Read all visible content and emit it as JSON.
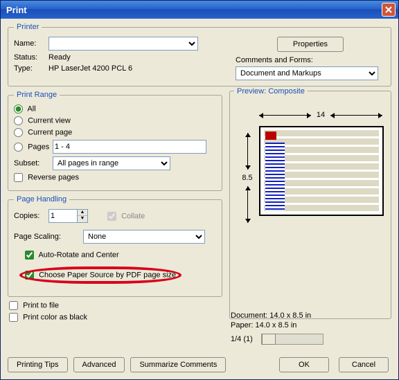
{
  "title": "Print",
  "printer": {
    "legend": "Printer",
    "name_label": "Name:",
    "name_value": "",
    "status_label": "Status:",
    "status_value": "Ready",
    "type_label": "Type:",
    "type_value": "HP LaserJet 4200 PCL 6",
    "properties_btn": "Properties",
    "comments_label": "Comments and Forms:",
    "comments_value": "Document and Markups"
  },
  "range": {
    "legend": "Print Range",
    "all": "All",
    "current_view": "Current view",
    "current_page": "Current page",
    "pages_label": "Pages",
    "pages_value": "1 - 4",
    "subset_label": "Subset:",
    "subset_value": "All pages in range",
    "reverse": "Reverse pages"
  },
  "handling": {
    "legend": "Page Handling",
    "copies_label": "Copies:",
    "copies_value": "1",
    "collate": "Collate",
    "scaling_label": "Page Scaling:",
    "scaling_value": "None",
    "autorotate": "Auto-Rotate and Center",
    "paper_source": "Choose Paper Source by PDF page size"
  },
  "file_opts": {
    "print_to_file": "Print to file",
    "print_as_black": "Print color as black"
  },
  "preview": {
    "legend": "Preview: Composite",
    "w": "14",
    "h": "8.5",
    "doc_size": "Document: 14.0 x 8.5 in",
    "paper_size": "Paper: 14.0 x 8.5 in",
    "counter": "1/4 (1)"
  },
  "bottom": {
    "tips": "Printing Tips",
    "advanced": "Advanced",
    "summarize": "Summarize Comments",
    "ok": "OK",
    "cancel": "Cancel"
  }
}
